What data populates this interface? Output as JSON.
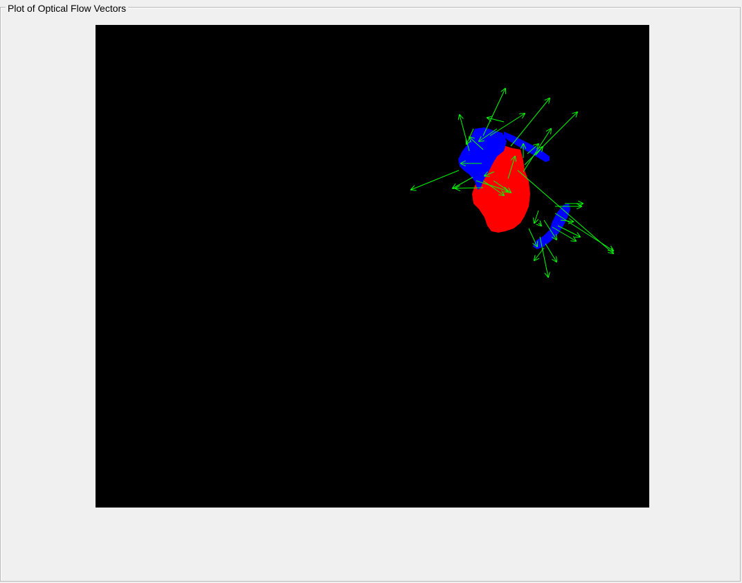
{
  "panel": {
    "title": "Plot of Optical Flow Vectors"
  },
  "plot": {
    "background_color": "#000000",
    "blob_colors": {
      "moving_red": "#ff0000",
      "moving_blue": "#0000ff"
    },
    "vector_color": "#00ff00"
  }
}
